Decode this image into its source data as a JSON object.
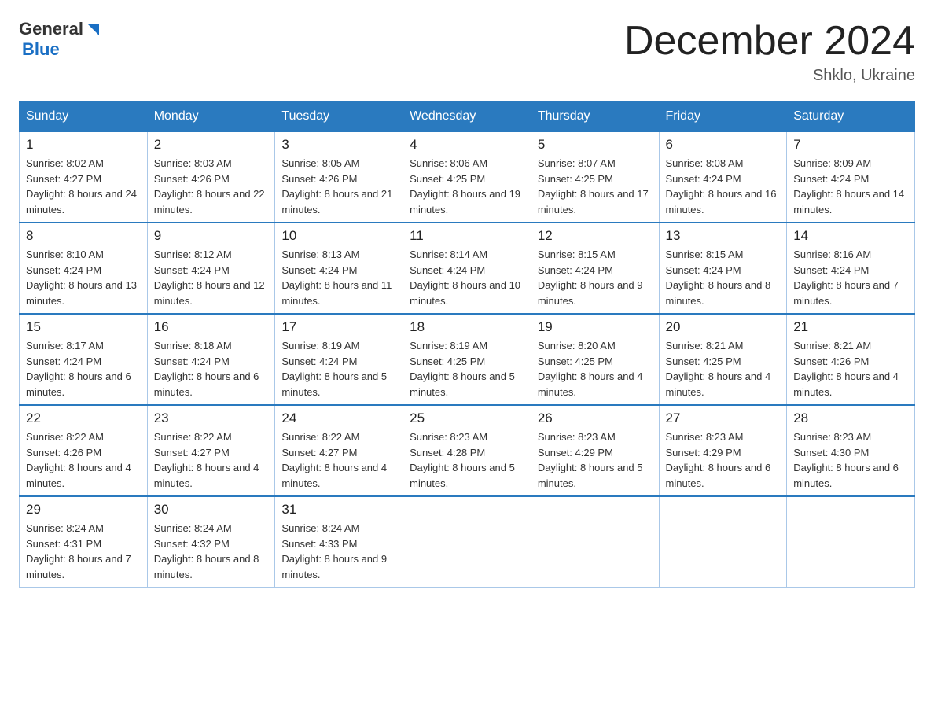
{
  "header": {
    "logo_general": "General",
    "logo_blue": "Blue",
    "month_title": "December 2024",
    "location": "Shklo, Ukraine"
  },
  "days_of_week": [
    "Sunday",
    "Monday",
    "Tuesday",
    "Wednesday",
    "Thursday",
    "Friday",
    "Saturday"
  ],
  "weeks": [
    [
      {
        "date": "1",
        "sunrise": "8:02 AM",
        "sunset": "4:27 PM",
        "daylight": "8 hours and 24 minutes."
      },
      {
        "date": "2",
        "sunrise": "8:03 AM",
        "sunset": "4:26 PM",
        "daylight": "8 hours and 22 minutes."
      },
      {
        "date": "3",
        "sunrise": "8:05 AM",
        "sunset": "4:26 PM",
        "daylight": "8 hours and 21 minutes."
      },
      {
        "date": "4",
        "sunrise": "8:06 AM",
        "sunset": "4:25 PM",
        "daylight": "8 hours and 19 minutes."
      },
      {
        "date": "5",
        "sunrise": "8:07 AM",
        "sunset": "4:25 PM",
        "daylight": "8 hours and 17 minutes."
      },
      {
        "date": "6",
        "sunrise": "8:08 AM",
        "sunset": "4:24 PM",
        "daylight": "8 hours and 16 minutes."
      },
      {
        "date": "7",
        "sunrise": "8:09 AM",
        "sunset": "4:24 PM",
        "daylight": "8 hours and 14 minutes."
      }
    ],
    [
      {
        "date": "8",
        "sunrise": "8:10 AM",
        "sunset": "4:24 PM",
        "daylight": "8 hours and 13 minutes."
      },
      {
        "date": "9",
        "sunrise": "8:12 AM",
        "sunset": "4:24 PM",
        "daylight": "8 hours and 12 minutes."
      },
      {
        "date": "10",
        "sunrise": "8:13 AM",
        "sunset": "4:24 PM",
        "daylight": "8 hours and 11 minutes."
      },
      {
        "date": "11",
        "sunrise": "8:14 AM",
        "sunset": "4:24 PM",
        "daylight": "8 hours and 10 minutes."
      },
      {
        "date": "12",
        "sunrise": "8:15 AM",
        "sunset": "4:24 PM",
        "daylight": "8 hours and 9 minutes."
      },
      {
        "date": "13",
        "sunrise": "8:15 AM",
        "sunset": "4:24 PM",
        "daylight": "8 hours and 8 minutes."
      },
      {
        "date": "14",
        "sunrise": "8:16 AM",
        "sunset": "4:24 PM",
        "daylight": "8 hours and 7 minutes."
      }
    ],
    [
      {
        "date": "15",
        "sunrise": "8:17 AM",
        "sunset": "4:24 PM",
        "daylight": "8 hours and 6 minutes."
      },
      {
        "date": "16",
        "sunrise": "8:18 AM",
        "sunset": "4:24 PM",
        "daylight": "8 hours and 6 minutes."
      },
      {
        "date": "17",
        "sunrise": "8:19 AM",
        "sunset": "4:24 PM",
        "daylight": "8 hours and 5 minutes."
      },
      {
        "date": "18",
        "sunrise": "8:19 AM",
        "sunset": "4:25 PM",
        "daylight": "8 hours and 5 minutes."
      },
      {
        "date": "19",
        "sunrise": "8:20 AM",
        "sunset": "4:25 PM",
        "daylight": "8 hours and 4 minutes."
      },
      {
        "date": "20",
        "sunrise": "8:21 AM",
        "sunset": "4:25 PM",
        "daylight": "8 hours and 4 minutes."
      },
      {
        "date": "21",
        "sunrise": "8:21 AM",
        "sunset": "4:26 PM",
        "daylight": "8 hours and 4 minutes."
      }
    ],
    [
      {
        "date": "22",
        "sunrise": "8:22 AM",
        "sunset": "4:26 PM",
        "daylight": "8 hours and 4 minutes."
      },
      {
        "date": "23",
        "sunrise": "8:22 AM",
        "sunset": "4:27 PM",
        "daylight": "8 hours and 4 minutes."
      },
      {
        "date": "24",
        "sunrise": "8:22 AM",
        "sunset": "4:27 PM",
        "daylight": "8 hours and 4 minutes."
      },
      {
        "date": "25",
        "sunrise": "8:23 AM",
        "sunset": "4:28 PM",
        "daylight": "8 hours and 5 minutes."
      },
      {
        "date": "26",
        "sunrise": "8:23 AM",
        "sunset": "4:29 PM",
        "daylight": "8 hours and 5 minutes."
      },
      {
        "date": "27",
        "sunrise": "8:23 AM",
        "sunset": "4:29 PM",
        "daylight": "8 hours and 6 minutes."
      },
      {
        "date": "28",
        "sunrise": "8:23 AM",
        "sunset": "4:30 PM",
        "daylight": "8 hours and 6 minutes."
      }
    ],
    [
      {
        "date": "29",
        "sunrise": "8:24 AM",
        "sunset": "4:31 PM",
        "daylight": "8 hours and 7 minutes."
      },
      {
        "date": "30",
        "sunrise": "8:24 AM",
        "sunset": "4:32 PM",
        "daylight": "8 hours and 8 minutes."
      },
      {
        "date": "31",
        "sunrise": "8:24 AM",
        "sunset": "4:33 PM",
        "daylight": "8 hours and 9 minutes."
      },
      null,
      null,
      null,
      null
    ]
  ]
}
